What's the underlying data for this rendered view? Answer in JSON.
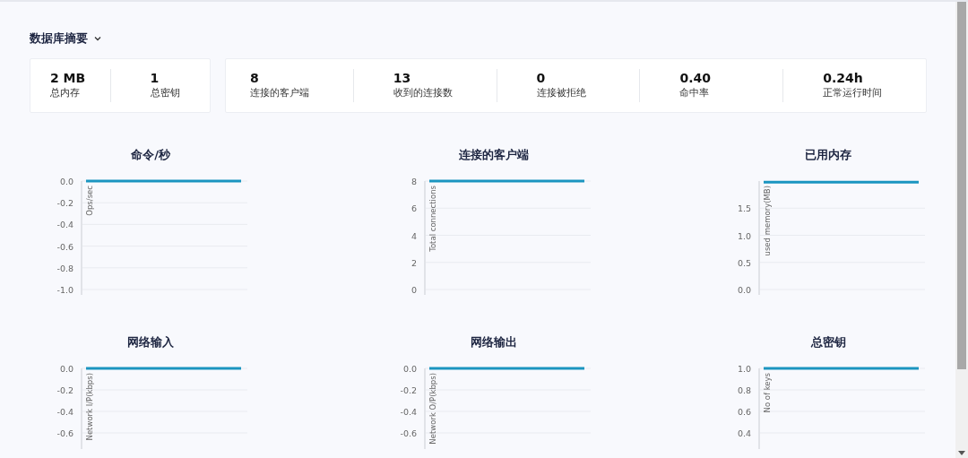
{
  "section": {
    "title": "数据库摘要",
    "expanded": true
  },
  "stat_groups": [
    [
      {
        "value": "2 MB",
        "label": "总内存"
      },
      {
        "value": "1",
        "label": "总密钥"
      }
    ],
    [
      {
        "value": "8",
        "label": "连接的客户端"
      },
      {
        "value": "13",
        "label": "收到的连接数"
      },
      {
        "value": "0",
        "label": "连接被拒绝"
      },
      {
        "value": "0.40",
        "label": "命中率"
      },
      {
        "value": "0.24h",
        "label": "正常运行时间"
      }
    ]
  ],
  "charts": [
    {
      "chart_data": {
        "type": "line",
        "title": "命令/秒",
        "ylabel": "Ops/sec",
        "grid": true,
        "ylim": [
          -1,
          0
        ],
        "yticks": [
          {
            "value": 0,
            "label": "0.0"
          },
          {
            "value": -0.2,
            "label": "-0.2"
          },
          {
            "value": -0.4,
            "label": "-0.4"
          },
          {
            "value": -0.6,
            "label": "-0.6"
          },
          {
            "value": -0.8,
            "label": "-0.8"
          },
          {
            "value": -1,
            "label": "-1.0"
          }
        ],
        "series": [
          {
            "color": "#1b95c0",
            "values": [
              0,
              0,
              0,
              0,
              0,
              0,
              0,
              0,
              0,
              0
            ]
          }
        ]
      }
    },
    {
      "chart_data": {
        "type": "line",
        "title": "连接的客户端",
        "ylabel": "Total connections",
        "grid": true,
        "ylim": [
          0,
          8
        ],
        "yticks": [
          {
            "value": 8,
            "label": "8"
          },
          {
            "value": 6,
            "label": "6"
          },
          {
            "value": 4,
            "label": "4"
          },
          {
            "value": 2,
            "label": "2"
          },
          {
            "value": 0,
            "label": "0"
          }
        ],
        "series": [
          {
            "color": "#1b95c0",
            "values": [
              8,
              8,
              8,
              8,
              8,
              8,
              8,
              8,
              8,
              8
            ]
          }
        ]
      }
    },
    {
      "chart_data": {
        "type": "line",
        "title": "已用内存",
        "ylabel": "used memory(MB)",
        "grid": true,
        "ylim": [
          0,
          2
        ],
        "yticks": [
          {
            "value": 1.5,
            "label": "1.5"
          },
          {
            "value": 1,
            "label": "1.0"
          },
          {
            "value": 0.5,
            "label": "0.5"
          },
          {
            "value": 0,
            "label": "0.0"
          }
        ],
        "series": [
          {
            "color": "#1b95c0",
            "values": [
              1.98,
              1.98,
              1.98,
              1.98,
              1.98,
              1.98,
              1.98,
              1.98,
              1.98,
              1.98
            ]
          }
        ]
      }
    },
    {
      "chart_data": {
        "type": "line",
        "title": "网络输入",
        "ylabel": "Network I/P(kbps)",
        "grid": true,
        "ylim": [
          -0.75,
          0
        ],
        "yticks": [
          {
            "value": 0,
            "label": "0.0"
          },
          {
            "value": -0.2,
            "label": "-0.2"
          },
          {
            "value": -0.4,
            "label": "-0.4"
          },
          {
            "value": -0.6,
            "label": "-0.6"
          }
        ],
        "series": [
          {
            "color": "#1b95c0",
            "values": [
              0,
              0,
              0,
              0,
              0,
              0,
              0,
              0,
              0,
              0
            ]
          }
        ]
      }
    },
    {
      "chart_data": {
        "type": "line",
        "title": "网络输出",
        "ylabel": "Network O/P(kbps)",
        "grid": true,
        "ylim": [
          -0.75,
          0
        ],
        "yticks": [
          {
            "value": 0,
            "label": "0.0"
          },
          {
            "value": -0.2,
            "label": "-0.2"
          },
          {
            "value": -0.4,
            "label": "-0.4"
          },
          {
            "value": -0.6,
            "label": "-0.6"
          }
        ],
        "series": [
          {
            "color": "#1b95c0",
            "values": [
              0,
              0,
              0,
              0,
              0,
              0,
              0,
              0,
              0,
              0
            ]
          }
        ]
      }
    },
    {
      "chart_data": {
        "type": "line",
        "title": "总密钥",
        "ylabel": "No of keys",
        "grid": true,
        "ylim": [
          0.25,
          1
        ],
        "yticks": [
          {
            "value": 1,
            "label": "1.0"
          },
          {
            "value": 0.8,
            "label": "0.8"
          },
          {
            "value": 0.6,
            "label": "0.6"
          },
          {
            "value": 0.4,
            "label": "0.4"
          }
        ],
        "series": [
          {
            "color": "#1b95c0",
            "values": [
              1,
              1,
              1,
              1,
              1,
              1,
              1,
              1,
              1,
              1
            ]
          }
        ]
      }
    }
  ]
}
